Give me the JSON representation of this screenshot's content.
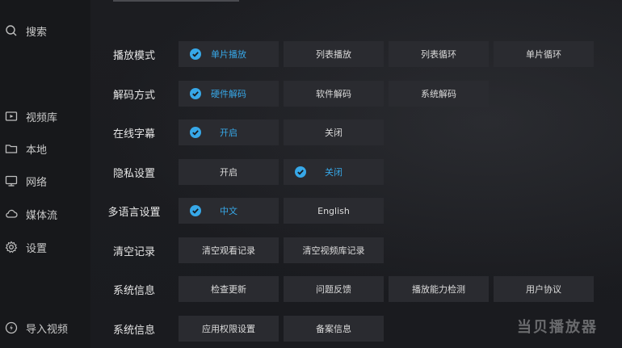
{
  "sidebar": {
    "search_label": "搜索",
    "items": [
      {
        "label": "视频库",
        "icon": "video-library-icon"
      },
      {
        "label": "本地",
        "icon": "folder-icon"
      },
      {
        "label": "网络",
        "icon": "network-icon"
      },
      {
        "label": "媒体流",
        "icon": "cloud-icon"
      },
      {
        "label": "设置",
        "icon": "gear-icon"
      }
    ],
    "import_label": "导入视频"
  },
  "settings": [
    {
      "label": "播放模式",
      "options": [
        "单片播放",
        "列表播放",
        "列表循环",
        "单片循环"
      ],
      "selected": 0
    },
    {
      "label": "解码方式",
      "options": [
        "硬件解码",
        "软件解码",
        "系统解码"
      ],
      "selected": 0
    },
    {
      "label": "在线字幕",
      "options": [
        "开启",
        "关闭"
      ],
      "selected": 0
    },
    {
      "label": "隐私设置",
      "options": [
        "开启",
        "关闭"
      ],
      "selected": 1
    },
    {
      "label": "多语言设置",
      "options": [
        "中文",
        "English"
      ],
      "selected": 0
    },
    {
      "label": "清空记录",
      "options": [
        "清空观看记录",
        "清空视频库记录"
      ],
      "selected": -1
    },
    {
      "label": "系统信息",
      "options": [
        "检查更新",
        "问题反馈",
        "播放能力检测",
        "用户协议"
      ],
      "selected": -1
    },
    {
      "label": "系统信息",
      "options": [
        "应用权限设置",
        "备案信息"
      ],
      "selected": -1
    }
  ],
  "watermark": "当贝播放器",
  "colors": {
    "accent": "#37a8e8",
    "button_bg": "#2a2b30",
    "background": "#1a1b1f"
  }
}
